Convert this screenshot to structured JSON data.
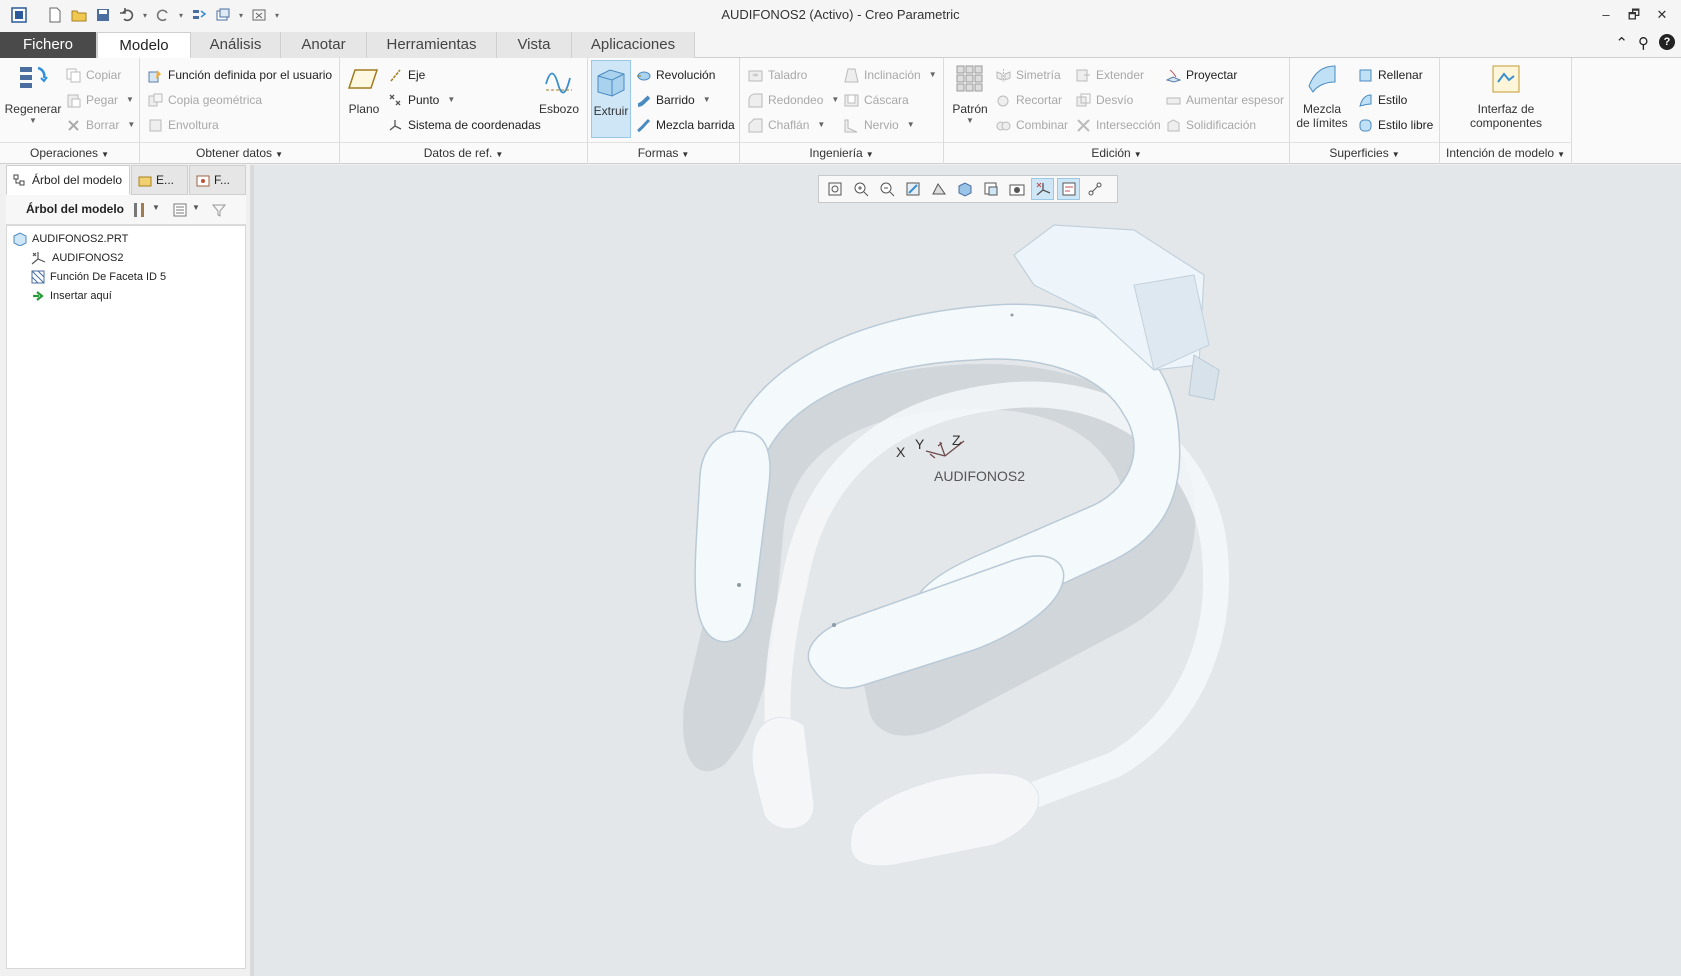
{
  "window": {
    "title": "AUDIFONOS2 (Activo) - Creo Parametric",
    "controls": [
      "–",
      "🗗",
      "✕"
    ]
  },
  "tabs": [
    {
      "label": "Fichero"
    },
    {
      "label": "Modelo"
    },
    {
      "label": "Análisis"
    },
    {
      "label": "Anotar"
    },
    {
      "label": "Herramientas"
    },
    {
      "label": "Vista"
    },
    {
      "label": "Aplicaciones"
    }
  ],
  "ribbon": {
    "operaciones": {
      "label": "Operaciones",
      "regenerar": "Regenerar",
      "copiar": "Copiar",
      "pegar": "Pegar",
      "borrar": "Borrar"
    },
    "obtener_datos": {
      "label": "Obtener datos",
      "funcion_usuario": "Función definida por el usuario",
      "copia_geometrica": "Copia geométrica",
      "envoltura": "Envoltura"
    },
    "datos_ref": {
      "label": "Datos de ref.",
      "plano": "Plano",
      "eje": "Eje",
      "punto": "Punto",
      "sistema": "Sistema de coordenadas",
      "esbozo": "Esbozo"
    },
    "formas": {
      "label": "Formas",
      "extruir": "Extruir",
      "revolucion": "Revolución",
      "barrido": "Barrido",
      "mezcla_barrida": "Mezcla barrida"
    },
    "ingenieria": {
      "label": "Ingeniería",
      "taladro": "Taladro",
      "redondeo": "Redondeo",
      "chaflan": "Chaflán",
      "inclinacion": "Inclinación",
      "cascara": "Cáscara",
      "nervio": "Nervio"
    },
    "edicion": {
      "label": "Edición",
      "patron": "Patrón",
      "simetria": "Simetría",
      "recortar": "Recortar",
      "combinar": "Combinar",
      "extender": "Extender",
      "desvio": "Desvío",
      "interseccion": "Intersección",
      "proyectar": "Proyectar",
      "aumentar_espesor": "Aumentar espesor",
      "solidificacion": "Solidificación"
    },
    "superficies": {
      "label": "Superficies",
      "mezcla_limites_1": "Mezcla",
      "mezcla_limites_2": "de límites",
      "rellenar": "Rellenar",
      "estilo": "Estilo",
      "estilo_libre": "Estilo libre"
    },
    "intencion": {
      "label": "Intención de modelo",
      "interfaz_1": "Interfaz de",
      "interfaz_2": "componentes"
    }
  },
  "left_panel": {
    "tabs": [
      "Árbol del modelo",
      "E...",
      "F..."
    ],
    "title": "Árbol del modelo",
    "tree": [
      {
        "label": "AUDIFONOS2.PRT"
      },
      {
        "label": "AUDIFONOS2"
      },
      {
        "label": "Función De Faceta ID 5"
      },
      {
        "label": "Insertar aquí"
      }
    ]
  },
  "viewport": {
    "csys_name": "AUDIFONOS2",
    "axes": [
      "X",
      "Y",
      "Z"
    ]
  },
  "colors": {
    "model": "#f4f9fc",
    "model_edge": "#b9cad6",
    "shadow": "#c9cdd2",
    "background": "#e4e7ea",
    "select": "#cfe6f7"
  }
}
